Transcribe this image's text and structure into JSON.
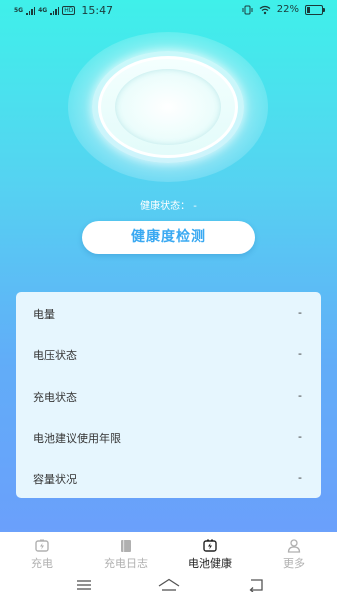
{
  "status_bar": {
    "signal_1": "5G",
    "signal_2": "4G",
    "hd": "HD",
    "time": "15:47",
    "battery_percent": "22%",
    "battery_level": 0.22
  },
  "health": {
    "status_label": "健康状态：",
    "status_value": "-",
    "check_button": "健康度检测"
  },
  "details": [
    {
      "label": "电量",
      "value": "-"
    },
    {
      "label": "电压状态",
      "value": "-"
    },
    {
      "label": "充电状态",
      "value": "-"
    },
    {
      "label": "电池建议使用年限",
      "value": "-"
    },
    {
      "label": "容量状况",
      "value": "-"
    }
  ],
  "tabs": [
    {
      "label": "充电",
      "icon": "charging-icon",
      "active": false
    },
    {
      "label": "充电日志",
      "icon": "log-book-icon",
      "active": false
    },
    {
      "label": "电池健康",
      "icon": "battery-health-icon",
      "active": true
    },
    {
      "label": "更多",
      "icon": "person-icon",
      "active": false
    }
  ],
  "nav": [
    "menu-icon",
    "home-icon",
    "back-icon"
  ],
  "colors": {
    "accent": "#3aa9f2",
    "card_bg": "#e6f6fe",
    "gradient_top": "#3ff0ea",
    "gradient_bottom": "#6aa0fb"
  }
}
